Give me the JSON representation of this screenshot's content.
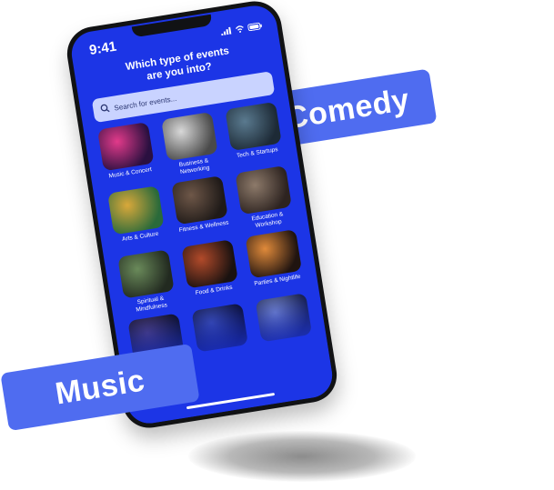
{
  "status_bar": {
    "time": "9:41"
  },
  "onboarding": {
    "title_line1": "Which type of events",
    "title_line2": "are you into?"
  },
  "search": {
    "placeholder": "Search for events..."
  },
  "categories": [
    {
      "label": "Music & Concert",
      "icon": "music-concert-image",
      "colors": [
        "#e23a8a",
        "#2a1040"
      ]
    },
    {
      "label": "Business & Networking",
      "icon": "business-networking-image",
      "colors": [
        "#d8d8d8",
        "#4a4a4a"
      ]
    },
    {
      "label": "Tech & Startups",
      "icon": "tech-startups-image",
      "colors": [
        "#5a7a8f",
        "#1d2a36"
      ]
    },
    {
      "label": "Arts & Culture",
      "icon": "arts-culture-image",
      "colors": [
        "#d9a83a",
        "#2a6a3a"
      ]
    },
    {
      "label": "Fitness & Wellness",
      "icon": "fitness-wellness-image",
      "colors": [
        "#6e5748",
        "#1f1a18"
      ]
    },
    {
      "label": "Education & Workshop",
      "icon": "education-workshop-image",
      "colors": [
        "#8d7a6a",
        "#2d2320"
      ]
    },
    {
      "label": "Spiritual & Mindfulness",
      "icon": "spiritual-mindfulness-image",
      "colors": [
        "#6a8a5a",
        "#222a20"
      ]
    },
    {
      "label": "Food & Drinks",
      "icon": "food-drinks-image",
      "colors": [
        "#b24a2a",
        "#1a1210"
      ]
    },
    {
      "label": "Parties & Nightlife",
      "icon": "parties-nightlife-image",
      "colors": [
        "#e08a3a",
        "#201410"
      ]
    },
    {
      "label": "",
      "icon": "crowd-image",
      "colors": [
        "#4a3a6a",
        "#101020"
      ]
    },
    {
      "label": "",
      "icon": "stage-lights-image",
      "colors": [
        "#3a4aa0",
        "#0d1030"
      ]
    },
    {
      "label": "",
      "icon": "concert-crowd-image",
      "colors": [
        "#7a8ac0",
        "#1a2040"
      ]
    }
  ],
  "tags": {
    "comedy": "Comedy",
    "music": "Music"
  },
  "colors": {
    "screen_blue": "#1c35e6",
    "pill_blue": "#4f6cf0",
    "search_bg": "#c9d3ff"
  }
}
